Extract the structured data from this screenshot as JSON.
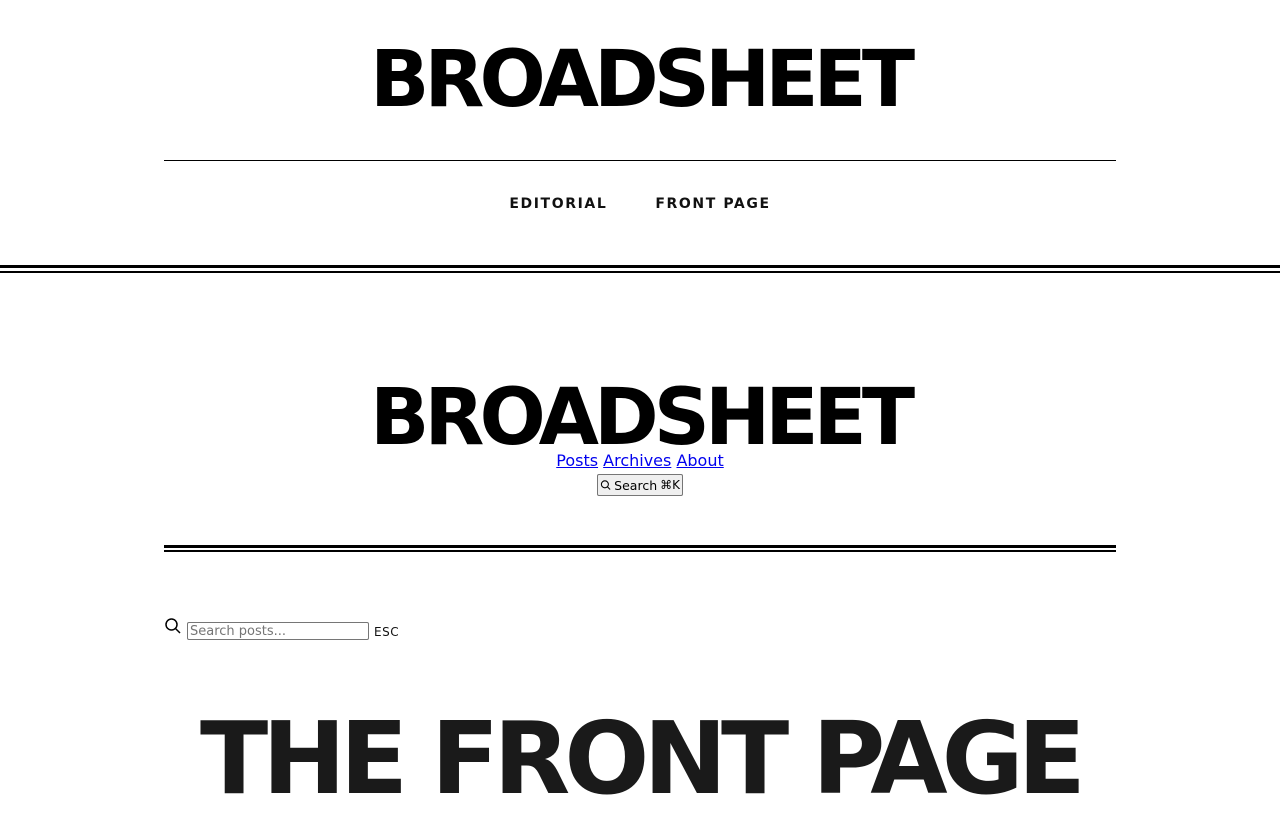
{
  "header": {
    "brand": "BROADSHEET",
    "nav": [
      {
        "label": "EDITORIAL"
      },
      {
        "label": "FRONT PAGE"
      }
    ]
  },
  "mid": {
    "brand": "BROADSHEET",
    "links": [
      {
        "label": "Posts"
      },
      {
        "label": "Archives"
      },
      {
        "label": "About"
      }
    ],
    "search_button": {
      "label": "Search",
      "shortcut": "⌘K",
      "icon": "search-icon"
    }
  },
  "search": {
    "placeholder": "Search posts...",
    "value": "",
    "esc_label": "ESC",
    "icon": "search-icon"
  },
  "page": {
    "title": "THE FRONT PAGE"
  }
}
